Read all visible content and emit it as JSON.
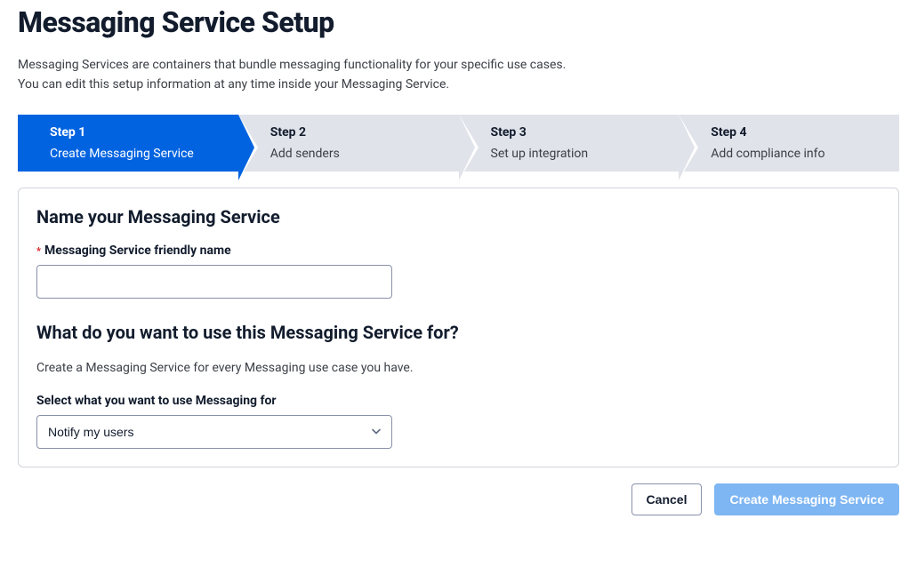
{
  "header": {
    "title": "Messaging Service Setup",
    "description_line1": "Messaging Services are containers that bundle messaging functionality for your specific use cases.",
    "description_line2": "You can edit this setup information at any time inside your Messaging Service."
  },
  "stepper": {
    "steps": [
      {
        "number": "Step 1",
        "label": "Create Messaging Service",
        "active": true
      },
      {
        "number": "Step 2",
        "label": "Add senders",
        "active": false
      },
      {
        "number": "Step 3",
        "label": "Set up integration",
        "active": false
      },
      {
        "number": "Step 4",
        "label": "Add compliance info",
        "active": false
      }
    ]
  },
  "form": {
    "name_section": {
      "title": "Name your Messaging Service",
      "field_label": "Messaging Service friendly name",
      "value": ""
    },
    "purpose_section": {
      "title": "What do you want to use this Messaging Service for?",
      "help_text": "Create a Messaging Service for every Messaging use case you have.",
      "select_label": "Select what you want to use Messaging for",
      "selected_option": "Notify my users"
    }
  },
  "footer": {
    "cancel_label": "Cancel",
    "submit_label": "Create Messaging Service"
  }
}
